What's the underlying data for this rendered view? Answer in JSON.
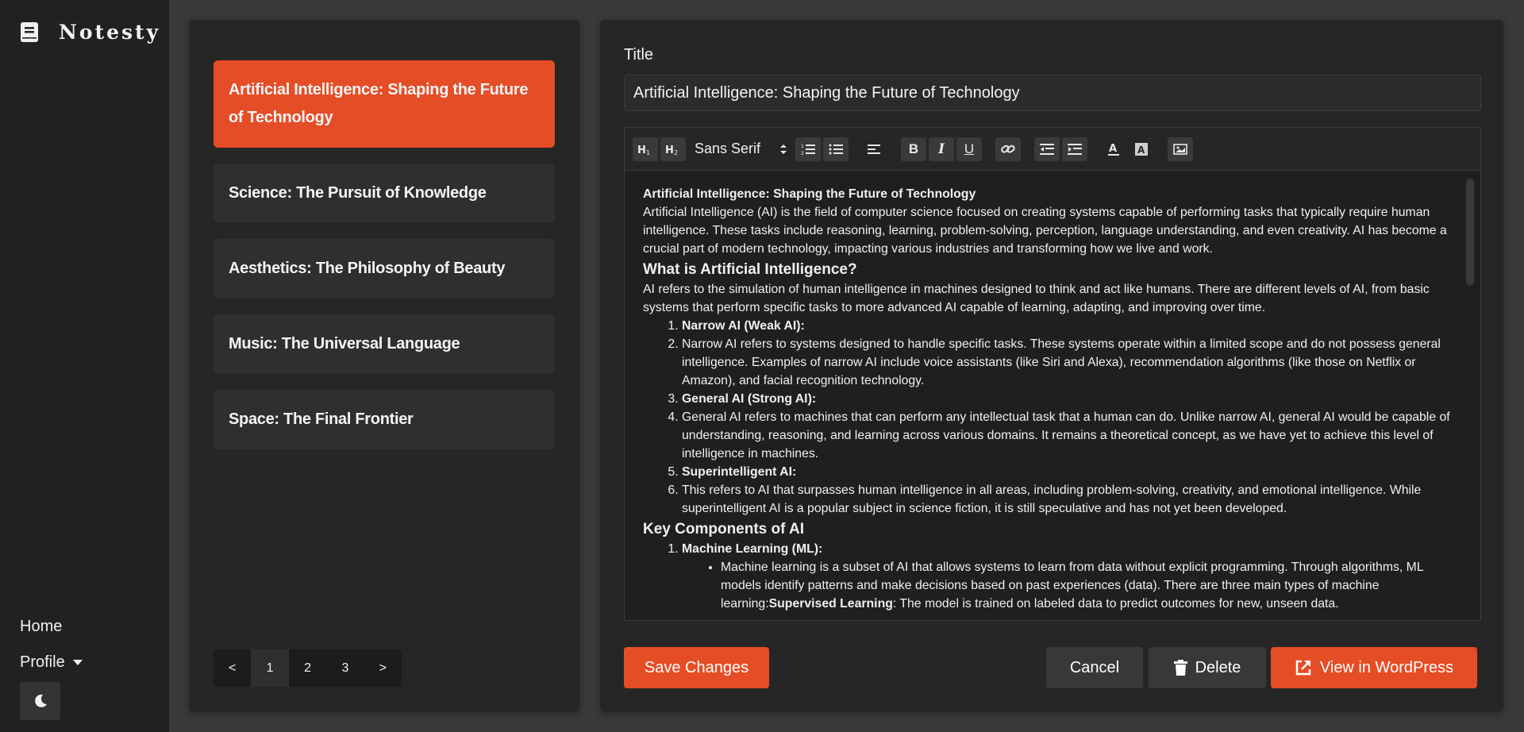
{
  "app": {
    "brand": "Notesty"
  },
  "nav": {
    "home": "Home",
    "profile": "Profile"
  },
  "notes": [
    "Artificial Intelligence: Shaping the Future of Technology",
    "Science: The Pursuit of Knowledge",
    "Aesthetics: The Philosophy of Beauty",
    "Music: The Universal Language",
    "Space: The Final Frontier"
  ],
  "pagination": {
    "prev": "<",
    "pages": [
      "1",
      "2",
      "3"
    ],
    "next": ">",
    "current": "1"
  },
  "editor": {
    "title_label": "Title",
    "title_value": "Artificial Intelligence: Shaping the Future of Technology",
    "font": "Sans Serif",
    "content": {
      "heading": "Artificial Intelligence: Shaping the Future of Technology",
      "intro": "Artificial Intelligence (AI) is the field of computer science focused on creating systems capable of performing tasks that typically require human intelligence. These tasks include reasoning, learning, problem-solving, perception, language understanding, and even creativity. AI has become a crucial part of modern technology, impacting various industries and transforming how we live and work.",
      "h_what": "What is Artificial Intelligence?",
      "p_what": "AI refers to the simulation of human intelligence in machines designed to think and act like humans. There are different levels of AI, from basic systems that perform specific tasks to more advanced AI capable of learning, adapting, and improving over time.",
      "list1": [
        "Narrow AI (Weak AI):",
        "Narrow AI refers to systems designed to handle specific tasks. These systems operate within a limited scope and do not possess general intelligence. Examples of narrow AI include voice assistants (like Siri and Alexa), recommendation algorithms (like those on Netflix or Amazon), and facial recognition technology.",
        "General AI (Strong AI):",
        "General AI refers to machines that can perform any intellectual task that a human can do. Unlike narrow AI, general AI would be capable of understanding, reasoning, and learning across various domains. It remains a theoretical concept, as we have yet to achieve this level of intelligence in machines.",
        "Superintelligent AI:",
        "This refers to AI that surpasses human intelligence in all areas, including problem-solving, creativity, and emotional intelligence. While superintelligent AI is a popular subject in science fiction, it is still speculative and has not yet been developed."
      ],
      "h_key": "Key Components of AI",
      "ml_title": "Machine Learning (ML):",
      "ml_text": "Machine learning is a subset of AI that allows systems to learn from data without explicit programming. Through algorithms, ML models identify patterns and make decisions based on past experiences (data). There are three main types of machine learning:",
      "sl_bold": "Supervised Learning",
      "sl_text": ": The model is trained on labeled data to predict outcomes for new, unseen data."
    }
  },
  "actions": {
    "save": "Save Changes",
    "cancel": "Cancel",
    "delete": "Delete",
    "view_wp": "View in WordPress"
  },
  "colors": {
    "accent": "#e54d26",
    "panel": "#262626",
    "sidebar": "#212121"
  }
}
